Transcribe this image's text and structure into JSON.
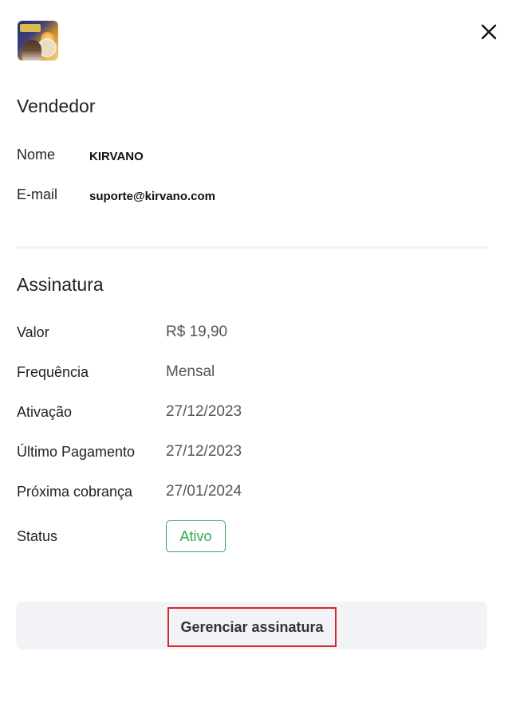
{
  "header": {
    "thumbnail_icon": "product-thumbnail-image",
    "close_icon": "close-icon"
  },
  "seller": {
    "title": "Vendedor",
    "name_label": "Nome",
    "name_value": "KIRVANO",
    "email_label": "E-mail",
    "email_value": "suporte@kirvano.com"
  },
  "subscription": {
    "title": "Assinatura",
    "rows": [
      {
        "label": "Valor",
        "value": "R$ 19,90"
      },
      {
        "label": "Frequência",
        "value": "Mensal"
      },
      {
        "label": "Ativação",
        "value": "27/12/2023"
      },
      {
        "label": "Último Pagamento",
        "value": "27/12/2023"
      },
      {
        "label": "Próxima cobrança",
        "value": "27/01/2024"
      }
    ],
    "status_label": "Status",
    "status_value": "Ativo"
  },
  "actions": {
    "manage_label": "Gerenciar assinatura"
  },
  "colors": {
    "status_green": "#2eaa55",
    "highlight_red": "#d7262e",
    "button_bg": "#f2f3f6",
    "divider": "#f1f2f4"
  }
}
